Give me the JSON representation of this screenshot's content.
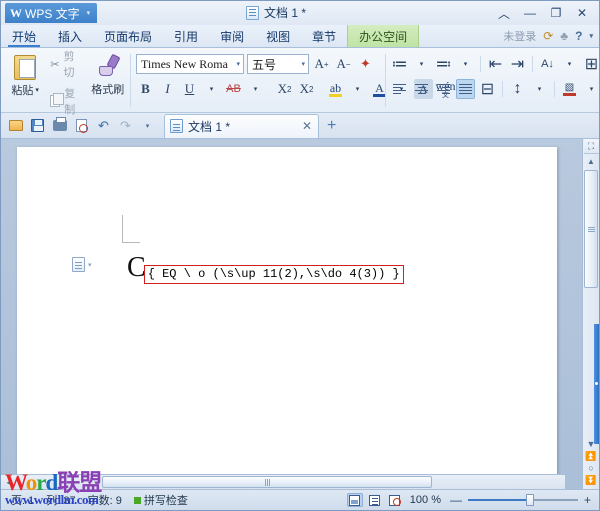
{
  "titlebar": {
    "app_name": "WPS 文字",
    "app_caret": "▾",
    "doc_title": "文档 1 *",
    "buttons": [
      {
        "name": "collapse-ribbon",
        "glyph": "︿"
      },
      {
        "name": "minimize",
        "glyph": "—"
      },
      {
        "name": "maximize",
        "glyph": "❐"
      },
      {
        "name": "close",
        "glyph": "✕"
      }
    ]
  },
  "menu": {
    "tabs": [
      {
        "label": "开始",
        "active": true
      },
      {
        "label": "插入",
        "active": false
      },
      {
        "label": "页面布局",
        "active": false
      },
      {
        "label": "引用",
        "active": false
      },
      {
        "label": "审阅",
        "active": false
      },
      {
        "label": "视图",
        "active": false
      },
      {
        "label": "章节",
        "active": false
      },
      {
        "label": "办公空间",
        "active": false,
        "highlight": true
      }
    ],
    "login_label": "未登录",
    "icons": [
      {
        "name": "sync-icon",
        "glyph": "⟳"
      },
      {
        "name": "shirt-icon",
        "glyph": "♣"
      },
      {
        "name": "help-icon",
        "glyph": "?"
      },
      {
        "name": "help-caret-icon",
        "glyph": "▾"
      }
    ]
  },
  "ribbon": {
    "clipboard": {
      "paste_label": "粘贴",
      "paste_caret": "▾",
      "cut_label": "剪切",
      "copy_label": "复制",
      "format_painter_label": "格式刷"
    },
    "font": {
      "font_name": "Times New Roma",
      "font_size": "五号",
      "grow_label": "A",
      "grow_sup": "+",
      "shrink_label": "A",
      "shrink_sup": "−",
      "clear_format_label": "✦",
      "bold_label": "B",
      "italic_label": "I",
      "underline_label": "U",
      "strike_label": "AB",
      "superscript_label": "X",
      "superscript_sup": "2",
      "subscript_label": "X",
      "subscript_sub": "2",
      "highlight_label": "ab",
      "fontcolor_label": "A",
      "charshade_label": "A",
      "pinyin_label": "wén",
      "pinyin_sub": "文",
      "dropdown_caret": "▾"
    },
    "paragraph": {
      "bullets_label": "≔",
      "numbering_label": "≕",
      "decrease_indent_label": "⇤",
      "increase_indent_label": "⇥",
      "sort_label": "A↓",
      "borders_label": "⊞",
      "show_marks_label": "¶",
      "align_left_label": "≡",
      "align_center_label": "≡",
      "align_right_label": "≡",
      "align_justify_label": "≡",
      "distribute_label": "⊟",
      "line_spacing_label": "↕",
      "shading_label": "▧",
      "border_label": "▢",
      "expand_label": "▸"
    }
  },
  "quickbar": {
    "buttons": [
      {
        "name": "open-button",
        "title": "打开"
      },
      {
        "name": "save-button",
        "title": "保存"
      },
      {
        "name": "print-button",
        "title": "打印"
      },
      {
        "name": "print-preview-button",
        "title": "打印预览"
      },
      {
        "name": "undo-button",
        "glyph": "↶"
      },
      {
        "name": "redo-button",
        "glyph": "↷"
      },
      {
        "name": "customize-button",
        "glyph": "▾"
      }
    ],
    "tab_label": "文档 1 *",
    "tab_close": "✕",
    "new_tab": "+"
  },
  "document": {
    "leading_char": "C",
    "field_code": "{ EQ \\ o (\\s\\up 11(2),\\s\\do 4(3)) }",
    "field_border_color": "#d21f1f"
  },
  "scrollbars": {
    "vertical": {
      "select_browse_icon": "⛶",
      "up_arrow": "▲",
      "down_arrow": "▼",
      "prev_page": "⏫",
      "browse_object": "○",
      "next_page": "⏬"
    },
    "horizontal": {
      "left_arrow": "◂",
      "right_arrow": "▸"
    }
  },
  "statusbar": {
    "page_label": "页: 1",
    "column_label": "列: 37",
    "wordcount_label": "字数: 9",
    "spellcheck_label": "拼写检查",
    "views": [
      {
        "name": "page-view",
        "active": true
      },
      {
        "name": "outline-view",
        "active": false
      },
      {
        "name": "web-view",
        "active": false
      }
    ],
    "zoom_label": "100 %",
    "zoom_minus": "—",
    "zoom_plus": "+"
  },
  "watermark": {
    "line1_parts": [
      {
        "t": "W",
        "c": "c1"
      },
      {
        "t": "o",
        "c": "c2"
      },
      {
        "t": "r",
        "c": "c3"
      },
      {
        "t": "d",
        "c": "c4"
      },
      {
        "t": "联盟",
        "c": "c5"
      }
    ],
    "line2": "www.wordlm.com"
  }
}
